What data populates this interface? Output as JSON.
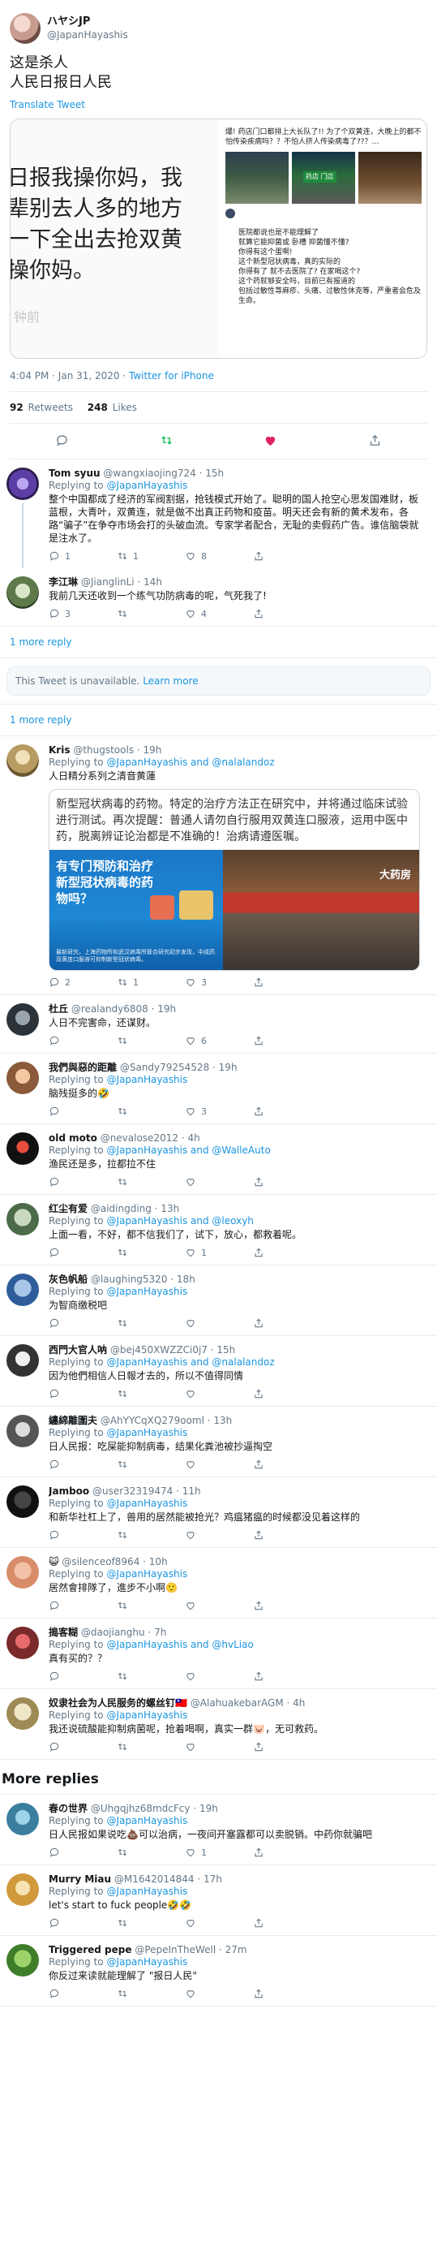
{
  "tweet": {
    "display_name": "ハヤシJP",
    "handle": "@JapanHayashis",
    "text_line1": "这是杀人",
    "text_line2": "人民日报日人民",
    "translate": "Translate Tweet",
    "image_left_text": "日报我操你妈，我\n辈别去人多的地方\n一下全出去抢双黄\n操你妈。",
    "image_left_faint": "钟前",
    "image_right_top": "爆! 药店门口都排上大长队了!! 为了个双黄连，大晚上的都不怕传染疾病吗？？不怕人挤人传染病毒了??？…",
    "image_right_sign": "药店 门店",
    "image_right_bottom": "医院都说也是不能理解了\n就算它能抑菌或 卧槽 抑菌懂不懂?\n你得有这个蛋啊!\n这个新型冠状病毒，真的实际的\n你得有了 就不去医院了? 在家喝这个?\n这个药就够安全吗，目前已有报道的\n包括过敏性荨麻疹、头痛、过敏性休克等，严重者会危及生命。",
    "timestamp": "4:04 PM · Jan 31, 2020",
    "via": "Twitter for iPhone",
    "retweets_count": "92",
    "retweets_label": "Retweets",
    "likes_count": "248",
    "likes_label": "Likes"
  },
  "replies_a": [
    {
      "name": "Tom syuu",
      "handle": "@wangxiaojing724",
      "time": "· 15h",
      "to": "@JapanHayashis",
      "text": "整个中国都成了经济的军阀割据，抢钱模式开始了。聪明的国人抢空心思发国难财，板蓝根，大青叶，双黄连，就是做不出真正药物和疫苗。明天还会有新的黄术发布，各路“骗子”在争夺市场会打的头破血流。专家学者配合，无耻的卖假药广告。谁信脑袋就是注水了。",
      "reply": "1",
      "rt": "1",
      "like": "8"
    },
    {
      "name": "李江琳",
      "handle": "@JianglinLi",
      "time": "· 14h",
      "to": "",
      "text": "我前几天还收到一个练气功防病毒的呢，气死我了!",
      "reply": "3",
      "rt": "",
      "like": "4"
    }
  ],
  "links": {
    "more_reply": "1 more reply",
    "unavailable": "This Tweet is unavailable.",
    "learn_more": "Learn more"
  },
  "kris": {
    "name": "Kris",
    "handle": "@thugstools",
    "time": "· 19h",
    "to": "@JapanHayashis and @nalalandoz",
    "text": "人日精分系列之清音黄蓮",
    "image_text": "新型冠状病毒的药物。特定的治疗方法正在研究中，并将通过临床试验进行测试。再次提醒：普通人请勿自行服用双黄连口服液，运用中医中药，脱离辨证论治都是不准确的！治病请遵医嘱。",
    "blue_title": "有专门预防和治疗新型冠状病毒的药物吗？",
    "blue_small": "最新研究，上海药物所和武汉病毒所联合研究初步发现，中成药双黄连口服液可抑制新型冠状病毒。",
    "photo_sign": "大药房",
    "reply": "2",
    "rt": "1",
    "like": "3"
  },
  "replies_b": [
    {
      "name": "杜丘",
      "handle": "@realandy6808",
      "time": "· 19h",
      "to": "",
      "text": "人日不完害命，还谋财。",
      "reply": "",
      "rt": "",
      "like": "6"
    },
    {
      "name": "我們與惡的距離",
      "handle": "@Sandy79254528",
      "time": "· 19h",
      "to": "@JapanHayashis",
      "text": "脑残挺多的🤣",
      "reply": "",
      "rt": "",
      "like": "3"
    },
    {
      "name": "old moto",
      "handle": "@nevalose2012",
      "time": "· 4h",
      "to": "@JapanHayashis and @WalleAuto",
      "text": "渔民还是多，拉都拉不住",
      "reply": "",
      "rt": "",
      "like": ""
    },
    {
      "name": "红尘有爱",
      "handle": "@aidingding",
      "time": "· 13h",
      "to": "@JapanHayashis and @leoxyh",
      "text": "上面一看，不好，都不信我们了，试下，放心，都救着呢。",
      "reply": "",
      "rt": "",
      "like": "1"
    },
    {
      "name": "灰色帆船",
      "handle": "@laughing5320",
      "time": "· 18h",
      "to": "@JapanHayashis",
      "text": "为智商缴税吧",
      "reply": "",
      "rt": "",
      "like": ""
    },
    {
      "name": "西門大官人呐",
      "handle": "@bej450XWZZCi0j7",
      "time": "· 15h",
      "to": "@JapanHayashis and @nalalandoz",
      "text": "因为他們相信人日報才去的，所以不值得同情",
      "reply": "",
      "rt": "",
      "like": ""
    },
    {
      "name": "纏綿離圍夫",
      "handle": "@AhYYCqXQ279ooml",
      "time": "· 13h",
      "to": "@JapanHayashis",
      "text": "日人民报：吃屎能抑制病毒，结果化粪池被抄逼掏空",
      "reply": "",
      "rt": "",
      "like": ""
    },
    {
      "name": "Jamboo",
      "handle": "@user32319474",
      "time": "· 11h",
      "to": "@JapanHayashis",
      "text": "和新华社杠上了，兽用的居然能被抢光？鸡瘟猪瘟的时候都没见着这样的",
      "reply": "",
      "rt": "",
      "like": ""
    },
    {
      "name": "😺",
      "handle": "@silenceof8964",
      "time": "· 10h",
      "to": "@JapanHayashis",
      "text": "居然會排隊了，進步不小啊🙂",
      "reply": "",
      "rt": "",
      "like": ""
    },
    {
      "name": "搗客糊",
      "handle": "@daojianghu",
      "time": "· 7h",
      "to": "@JapanHayashis and @hvLiao",
      "text": "真有买的？？",
      "reply": "",
      "rt": "",
      "like": ""
    },
    {
      "name": "奴隶社会为人民服务的螺丝钉🇹🇼",
      "handle": "@AlahuakebarAGM",
      "time": "· 4h",
      "to": "@JapanHayashis",
      "text": "我还说硫酸能抑制病菌呢，抢着喝啊，真实一群🐷，无可救药。",
      "reply": "",
      "rt": "",
      "like": ""
    }
  ],
  "more_replies": "More replies",
  "replies_c": [
    {
      "name": "春の世界",
      "handle": "@Uhgqjhz68mdcFcy",
      "time": "· 19h",
      "to": "@JapanHayashis",
      "text": "日人民报如果说吃💩可以治病，一夜间开塞露都可以卖脱销。中药你就骗吧",
      "reply": "",
      "rt": "",
      "like": "1"
    },
    {
      "name": "Murry Miau",
      "handle": "@M1642014844",
      "time": "· 17h",
      "to": "@JapanHayashis",
      "text": "let's start to fuck people🤣🤣",
      "reply": "",
      "rt": "",
      "like": ""
    },
    {
      "name": "Triggered pepe",
      "handle": "@PepeInTheWell",
      "time": "· 27m",
      "to": "@JapanHayashis",
      "text": "你反过来读就能理解了 \"报日人民\"",
      "reply": "",
      "rt": "",
      "like": ""
    }
  ],
  "colors": {
    "link": "#1b95e0",
    "like_active": "#e0245e",
    "retweet_active": "#17bf63",
    "muted": "#657786"
  },
  "icons": [
    "reply-icon",
    "retweet-icon",
    "like-icon",
    "share-icon"
  ]
}
